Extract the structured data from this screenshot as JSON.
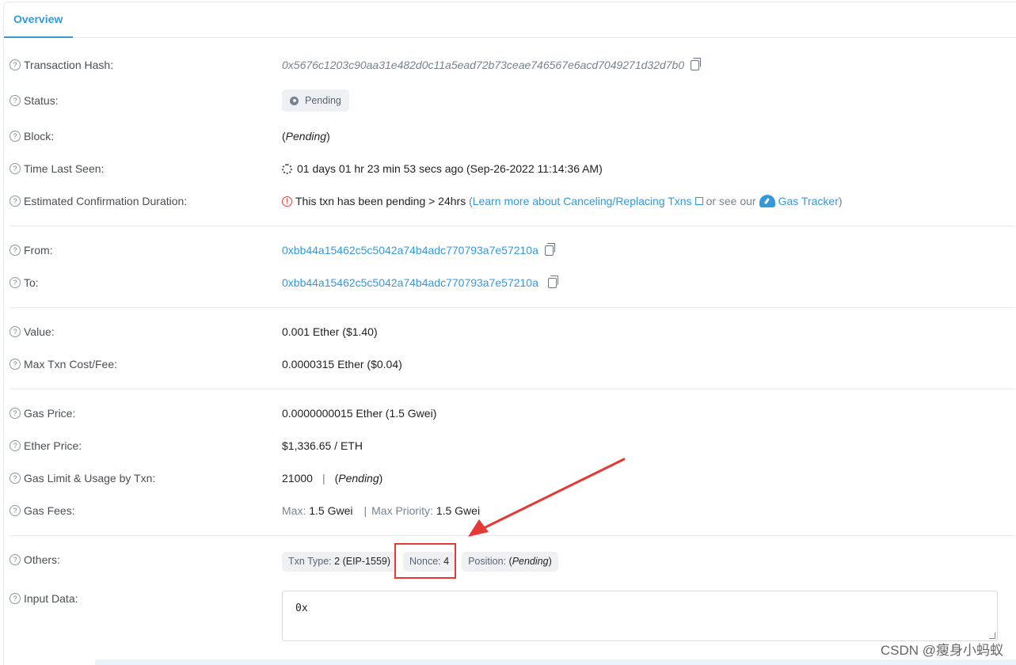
{
  "tabs": {
    "overview": "Overview"
  },
  "rows": {
    "txhash": {
      "label": "Transaction Hash:",
      "value": "0x5676c1203c90aa31e482d0c11a5ead72b73ceae746567e6acd7049271d32d7b0"
    },
    "status": {
      "label": "Status:",
      "value": "Pending"
    },
    "block": {
      "label": "Block:",
      "open": "(",
      "value": "Pending",
      "close": ")"
    },
    "timeseen": {
      "label": "Time Last Seen:",
      "value": "01 days 01 hr 23 min 53 secs ago (Sep-26-2022 11:14:36 AM)"
    },
    "estconf": {
      "label": "Estimated Confirmation Duration:",
      "text": "This txn has been pending > 24hrs",
      "open": "(",
      "learn_link": "Learn more about Canceling/Replacing Txns",
      "middle": "or see our",
      "gas_link": "Gas Tracker",
      "close": ")"
    },
    "from": {
      "label": "From:",
      "value": "0xbb44a15462c5c5042a74b4adc770793a7e57210a"
    },
    "to": {
      "label": "To:",
      "value": "0xbb44a15462c5c5042a74b4adc770793a7e57210a"
    },
    "value": {
      "label": "Value:",
      "value": "0.001 Ether ($1.40)"
    },
    "maxfee": {
      "label": "Max Txn Cost/Fee:",
      "value": "0.0000315 Ether ($0.04)"
    },
    "gasprice": {
      "label": "Gas Price:",
      "value": "0.0000000015 Ether (1.5 Gwei)"
    },
    "etherprice": {
      "label": "Ether Price:",
      "value": "$1,336.65 / ETH"
    },
    "gaslimit": {
      "label": "Gas Limit & Usage by Txn:",
      "limit": "21000",
      "sep": "|",
      "open": "(",
      "usage": "Pending",
      "close": ")"
    },
    "gasfees": {
      "label": "Gas Fees:",
      "max_label": "Max:",
      "max_value": "1.5 Gwei",
      "sep": "|",
      "prio_label": "Max Priority:",
      "prio_value": "1.5 Gwei"
    },
    "others": {
      "label": "Others:",
      "txtype_label": "Txn Type:",
      "txtype_value": "2 (EIP-1559)",
      "nonce_label": "Nonce:",
      "nonce_value": "4",
      "position_label": "Position:",
      "position_open": "(",
      "position_value": "Pending",
      "position_close": ")"
    },
    "input": {
      "label": "Input Data:",
      "value": "0x"
    }
  },
  "watermark": "CSDN @瘦身小蚂蚁",
  "colors": {
    "link": "#3498db",
    "annotation": "#e53935"
  }
}
